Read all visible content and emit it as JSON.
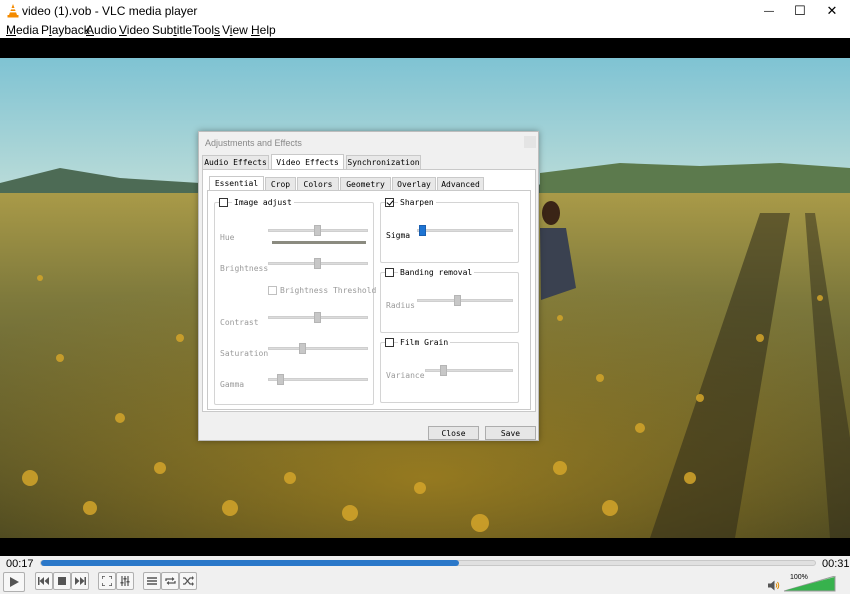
{
  "window": {
    "title": "video (1).vob - VLC media player",
    "minimize_glyph": "—",
    "maximize_glyph": "☐",
    "close_glyph": "✕"
  },
  "menu": {
    "items": [
      {
        "label": "Media",
        "key": "M"
      },
      {
        "label": "Playback",
        "key": "l"
      },
      {
        "label": "Audio",
        "key": "A"
      },
      {
        "label": "Video",
        "key": "V"
      },
      {
        "label": "Subtitle",
        "key": "t"
      },
      {
        "label": "Tools",
        "key": "s"
      },
      {
        "label": "View",
        "key": "i"
      },
      {
        "label": "Help",
        "key": "H"
      }
    ]
  },
  "dialog": {
    "title": "Adjustments and Effects",
    "tabs": [
      "Audio Effects",
      "Video Effects",
      "Synchronization"
    ],
    "active_tab": "Video Effects",
    "subtabs": [
      "Essential",
      "Crop",
      "Colors",
      "Geometry",
      "Overlay",
      "Advanced"
    ],
    "active_subtab": "Essential",
    "image_adjust": {
      "label": "Image adjust",
      "checked": false,
      "hue_label": "Hue",
      "brightness_label": "Brightness",
      "brightness_threshold_label": "Brightness Threshold",
      "contrast_label": "Contrast",
      "saturation_label": "Saturation",
      "gamma_label": "Gamma"
    },
    "sharpen": {
      "label": "Sharpen",
      "checked": true,
      "sigma_label": "Sigma"
    },
    "banding": {
      "label": "Banding removal",
      "checked": false,
      "radius_label": "Radius"
    },
    "film_grain": {
      "label": "Film Grain",
      "checked": false,
      "variance_label": "Variance"
    },
    "close_label": "Close",
    "save_label": "Save"
  },
  "player": {
    "elapsed": "00:17",
    "total": "00:31",
    "progress_fraction": 0.54,
    "volume_label": "100%",
    "accent_color": "#2b78c9"
  }
}
